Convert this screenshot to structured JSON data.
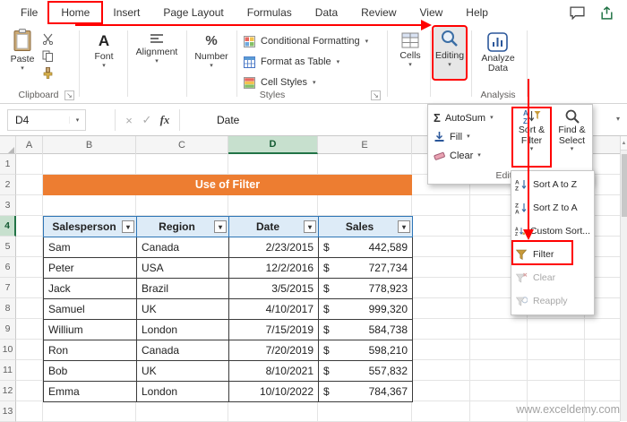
{
  "menu": {
    "tabs": [
      "File",
      "Home",
      "Insert",
      "Page Layout",
      "Formulas",
      "Data",
      "Review",
      "View",
      "Help"
    ]
  },
  "ribbon": {
    "paste": "Paste",
    "clipboard_group": "Clipboard",
    "font_group": "Font",
    "alignment_group": "Alignment",
    "number_group": "Number",
    "conditional_formatting": "Conditional Formatting",
    "format_as_table": "Format as Table",
    "cell_styles": "Cell Styles",
    "styles_group": "Styles",
    "cells_group": "Cells",
    "editing_group": "Editing",
    "analyze_data": "Analyze Data",
    "analysis_group": "Analysis"
  },
  "formula_bar": {
    "name_box": "D4",
    "fx": "fx",
    "value": "Date"
  },
  "editing_menu": {
    "autosum": "AutoSum",
    "fill": "Fill",
    "clear": "Clear",
    "sort_filter_line1": "Sort &",
    "sort_filter_line2": "Filter",
    "find_select_line1": "Find &",
    "find_select_line2": "Select",
    "group_label": "Editing"
  },
  "sort_menu": {
    "sort_az": "Sort A to Z",
    "sort_za": "Sort Z to A",
    "custom_sort": "Custom Sort...",
    "filter": "Filter",
    "clear": "Clear",
    "reapply": "Reapply"
  },
  "grid": {
    "columns": [
      "A",
      "B",
      "C",
      "D",
      "E"
    ],
    "rows": [
      "1",
      "2",
      "3",
      "4",
      "5",
      "6",
      "7",
      "8",
      "9",
      "10",
      "11",
      "12",
      "13"
    ],
    "selected_cell": "D4"
  },
  "sheet": {
    "banner": "Use of Filter",
    "currency": "$",
    "headers": [
      "Salesperson",
      "Region",
      "Date",
      "Sales"
    ],
    "rows": [
      {
        "salesperson": "Sam",
        "region": "Canada",
        "date": "2/23/2015",
        "sales": "442,589"
      },
      {
        "salesperson": "Peter",
        "region": "USA",
        "date": "12/2/2016",
        "sales": "727,734"
      },
      {
        "salesperson": "Jack",
        "region": "Brazil",
        "date": "3/5/2015",
        "sales": "778,923"
      },
      {
        "salesperson": "Samuel",
        "region": "UK",
        "date": "4/10/2017",
        "sales": "999,320"
      },
      {
        "salesperson": "Willium",
        "region": "London",
        "date": "7/15/2019",
        "sales": "584,738"
      },
      {
        "salesperson": "Ron",
        "region": "Canada",
        "date": "7/20/2019",
        "sales": "598,210"
      },
      {
        "salesperson": "Bob",
        "region": "UK",
        "date": "8/10/2021",
        "sales": "557,832"
      },
      {
        "salesperson": "Emma",
        "region": "London",
        "date": "10/10/2022",
        "sales": "784,367"
      }
    ]
  },
  "icons": {
    "caret": "▾",
    "scroll_up": "▲",
    "check": "✓",
    "cancel": "×",
    "sigma": "Σ",
    "launcher": "↘",
    "percent": "%",
    "font_a": "A"
  },
  "watermark": "www.exceldemy.com",
  "colors": {
    "annotation_red": "#FF0000",
    "banner_orange": "#ED7D31",
    "table_header_fill": "#DDEBF7",
    "table_header_border": "#2E75B6",
    "selection_green": "#217346"
  }
}
